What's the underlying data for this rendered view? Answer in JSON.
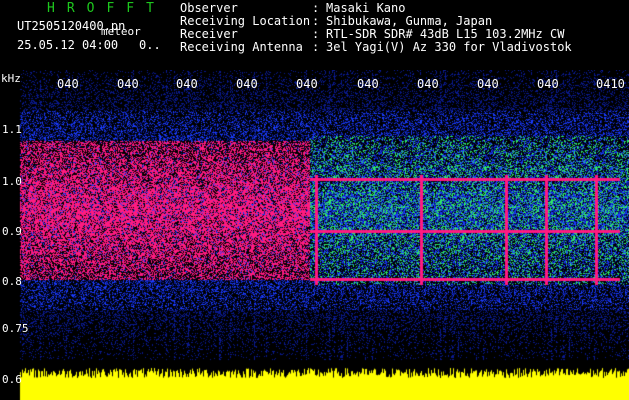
{
  "header": {
    "logo": "HROFFT",
    "filename": "UT2505120400.pn",
    "tag": "meteor",
    "timestamp": "25.05.12 04:00",
    "timestamp_suffix": "0..",
    "fields": [
      {
        "key": "Observer",
        "value": "Masaki Kano"
      },
      {
        "key": "Receiving Location",
        "value": "Shibukawa, Gunma, Japan"
      },
      {
        "key": "Receiver",
        "value": "RTL-SDR SDR# 43dB L15 103.2MHz CW"
      },
      {
        "key": "Receiving Antenna",
        "value": "3el Yagi(V) Az 330 for Vladivostok"
      }
    ]
  },
  "chart_data": {
    "type": "heatmap",
    "ylabel": "kHz",
    "y_ticks": [
      "1.1",
      "1.0",
      "0.9",
      "0.8",
      "0.75",
      "0.6"
    ],
    "x_ticks": [
      "040",
      "040",
      "040",
      "040",
      "040",
      "040",
      "040",
      "040",
      "040",
      "0410"
    ],
    "colors": {
      "strong": "#ff1a80",
      "mid": "#2ee86a",
      "low": "#1a3cff",
      "faint": "#0a1a90",
      "bg": "#000000",
      "meter": "#ffff00"
    }
  }
}
